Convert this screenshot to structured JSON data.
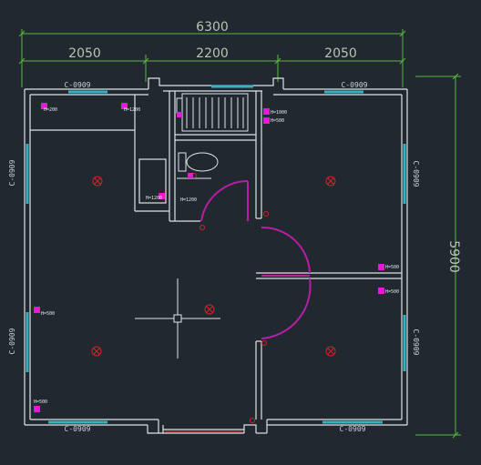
{
  "dimensions": {
    "total_width": "6300",
    "span_left": "2050",
    "span_mid": "2200",
    "span_right": "2050",
    "total_height": "5900"
  },
  "window_labels": {
    "top_left": "C-0909",
    "top_right": "C-0909",
    "left_upper": "C-0909",
    "left_lower": "C-0909",
    "right_upper": "C-0909",
    "right_lower": "C-0909",
    "bottom_left": "C-0909",
    "bottom_right": "C-0909"
  },
  "outlet_tags": {
    "tl_a": "H=200",
    "tl_b": "H=1200",
    "bath_a": "H=1000",
    "bath_b": "H=500",
    "toilet": "H=1200",
    "corridor": "H=1200",
    "right_a": "H=500",
    "right_b": "H=500",
    "left_a": "H=500",
    "left_b": "H=500"
  },
  "colors": {
    "background": "#212830",
    "wall": "#dfe3e6",
    "dimension": "#58b83e",
    "window": "#33b3c4",
    "door": "#b81ea4",
    "socket": "#e51ad8",
    "light": "#d9202a"
  }
}
